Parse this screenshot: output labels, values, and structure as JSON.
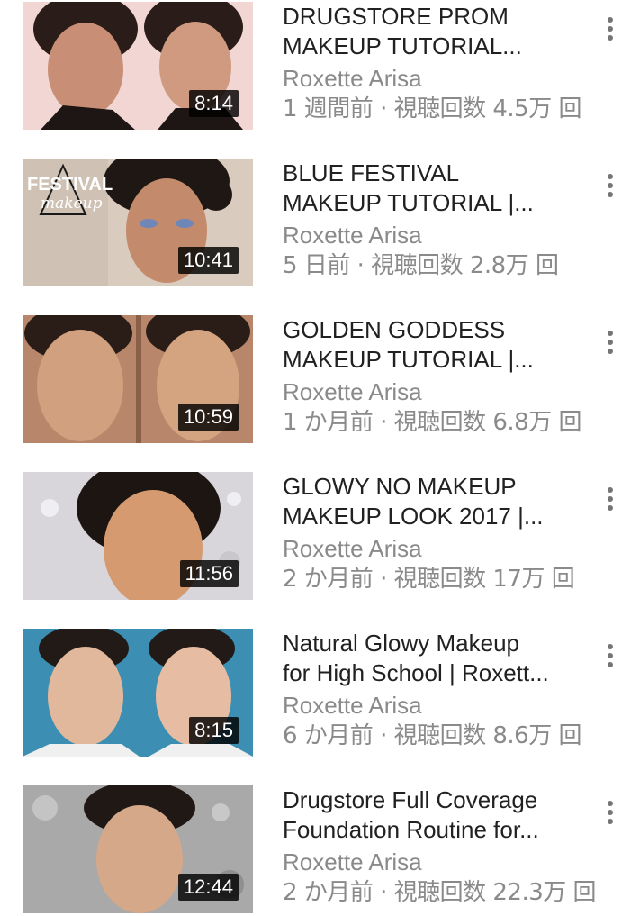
{
  "videos": [
    {
      "title_line1": "DRUGSTORE PROM",
      "title_line2": "MAKEUP TUTORIAL...",
      "channel": "Roxette Arisa",
      "stats": "1 週間前 · 視聴回数 4.5万 回",
      "duration": "8:14",
      "thumb_colors": [
        "#f1d6d4",
        "#c98f76",
        "#2a1c18"
      ]
    },
    {
      "title_line1": "BLUE FESTIVAL",
      "title_line2": "MAKEUP TUTORIAL |...",
      "channel": "Roxette Arisa",
      "stats": "5 日前 · 視聴回数 2.8万 回",
      "duration": "10:41",
      "thumb_colors": [
        "#d9cbbd",
        "#c48a6c",
        "#1f1714"
      ],
      "thumb_overlay_text1": "FESTIVAL",
      "thumb_overlay_text2": "makeup"
    },
    {
      "title_line1": "GOLDEN GODDESS",
      "title_line2": "MAKEUP TUTORIAL |...",
      "channel": "Roxette Arisa",
      "stats": "1 か月前 · 視聴回数 6.8万 回",
      "duration": "10:59",
      "thumb_colors": [
        "#b8866a",
        "#d1a07e",
        "#2a1d17"
      ]
    },
    {
      "title_line1": "GLOWY NO MAKEUP",
      "title_line2": "MAKEUP LOOK 2017 |...",
      "channel": "Roxette Arisa",
      "stats": "2 か月前 · 視聴回数 17万 回",
      "duration": "11:56",
      "thumb_colors": [
        "#d8d6da",
        "#d69a70",
        "#1c1512"
      ]
    },
    {
      "title_line1": "Natural Glowy Makeup",
      "title_line2": "for High School | Roxett...",
      "channel": "Roxette Arisa",
      "stats": "6 か月前 · 視聴回数 8.6万 回",
      "duration": "8:15",
      "thumb_colors": [
        "#3c8fb2",
        "#e2b89d",
        "#221a17"
      ]
    },
    {
      "title_line1": "Drugstore Full Coverage",
      "title_line2": "Foundation Routine for...",
      "channel": "Roxette Arisa",
      "stats": "2 か月前 · 視聴回数 22.3万 回",
      "duration": "12:44",
      "thumb_colors": [
        "#a9a9a9",
        "#d5a88a",
        "#201815"
      ]
    }
  ]
}
